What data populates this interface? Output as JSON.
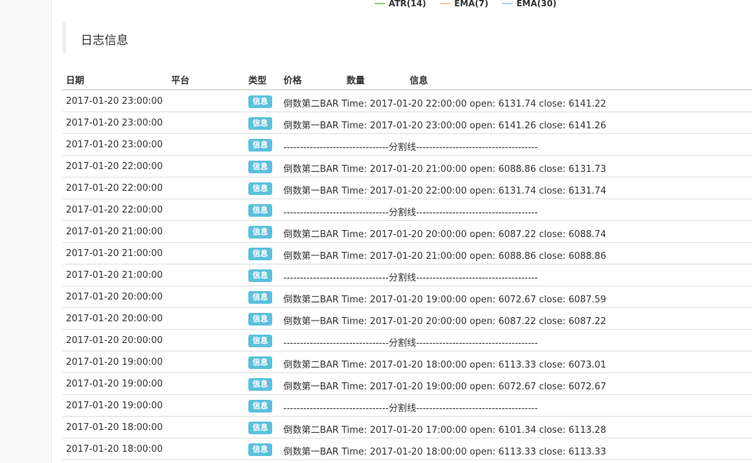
{
  "legend": [
    {
      "label": "ATR(14)",
      "color": "#8fcf72"
    },
    {
      "label": "EMA(7)",
      "color": "#f5c89a"
    },
    {
      "label": "EMA(30)",
      "color": "#a9cdea"
    }
  ],
  "section": {
    "title": "日志信息"
  },
  "table": {
    "headers": {
      "date": "日期",
      "platform": "平台",
      "type": "类型",
      "price": "价格",
      "quantity": "数量",
      "info": "信息"
    },
    "rows": [
      {
        "date": "2017-01-20 23:00:00",
        "type": "信息",
        "info": "倒数第二BAR Time: 2017-01-20 22:00:00 open: 6131.74 close: 6141.22"
      },
      {
        "date": "2017-01-20 23:00:00",
        "type": "信息",
        "info": "倒数第一BAR Time: 2017-01-20 23:00:00 open: 6141.26 close: 6141.26"
      },
      {
        "date": "2017-01-20 23:00:00",
        "type": "信息",
        "info": "--------------------------------分割线-------------------------------------"
      },
      {
        "date": "2017-01-20 22:00:00",
        "type": "信息",
        "info": "倒数第二BAR Time: 2017-01-20 21:00:00 open: 6088.86 close: 6131.73"
      },
      {
        "date": "2017-01-20 22:00:00",
        "type": "信息",
        "info": "倒数第一BAR Time: 2017-01-20 22:00:00 open: 6131.74 close: 6131.74"
      },
      {
        "date": "2017-01-20 22:00:00",
        "type": "信息",
        "info": "--------------------------------分割线-------------------------------------"
      },
      {
        "date": "2017-01-20 21:00:00",
        "type": "信息",
        "info": "倒数第二BAR Time: 2017-01-20 20:00:00 open: 6087.22 close: 6088.74"
      },
      {
        "date": "2017-01-20 21:00:00",
        "type": "信息",
        "info": "倒数第一BAR Time: 2017-01-20 21:00:00 open: 6088.86 close: 6088.86"
      },
      {
        "date": "2017-01-20 21:00:00",
        "type": "信息",
        "info": "--------------------------------分割线-------------------------------------"
      },
      {
        "date": "2017-01-20 20:00:00",
        "type": "信息",
        "info": "倒数第二BAR Time: 2017-01-20 19:00:00 open: 6072.67 close: 6087.59"
      },
      {
        "date": "2017-01-20 20:00:00",
        "type": "信息",
        "info": "倒数第一BAR Time: 2017-01-20 20:00:00 open: 6087.22 close: 6087.22"
      },
      {
        "date": "2017-01-20 20:00:00",
        "type": "信息",
        "info": "--------------------------------分割线-------------------------------------"
      },
      {
        "date": "2017-01-20 19:00:00",
        "type": "信息",
        "info": "倒数第二BAR Time: 2017-01-20 18:00:00 open: 6113.33 close: 6073.01"
      },
      {
        "date": "2017-01-20 19:00:00",
        "type": "信息",
        "info": "倒数第一BAR Time: 2017-01-20 19:00:00 open: 6072.67 close: 6072.67"
      },
      {
        "date": "2017-01-20 19:00:00",
        "type": "信息",
        "info": "--------------------------------分割线-------------------------------------"
      },
      {
        "date": "2017-01-20 18:00:00",
        "type": "信息",
        "info": "倒数第二BAR Time: 2017-01-20 17:00:00 open: 6101.34 close: 6113.28"
      },
      {
        "date": "2017-01-20 18:00:00",
        "type": "信息",
        "info": "倒数第一BAR Time: 2017-01-20 18:00:00 open: 6113.33 close: 6113.33"
      }
    ]
  }
}
